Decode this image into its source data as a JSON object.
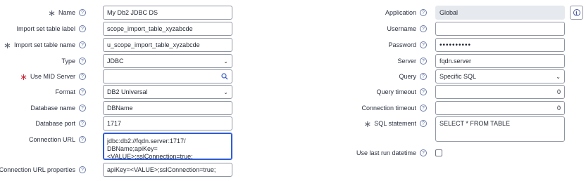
{
  "left": {
    "name": {
      "label": "Name",
      "value": "My Db2 JDBC DS"
    },
    "import_set_label": {
      "label": "Import set table label",
      "value": "scope_import_table_xyzabcde"
    },
    "import_set_name": {
      "label": "Import set table name",
      "value": "u_scope_import_table_xyzabcde"
    },
    "type": {
      "label": "Type",
      "value": "JDBC"
    },
    "use_mid_server": {
      "label": "Use MID Server",
      "value": ""
    },
    "format": {
      "label": "Format",
      "value": "DB2 Universal"
    },
    "database_name": {
      "label": "Database name",
      "value": "DBName"
    },
    "database_port": {
      "label": "Database port",
      "value": "1717"
    },
    "connection_url": {
      "label": "Connection URL",
      "value": "jdbc:db2://fqdn.server:1717/ DBName;apiKey=<VALUE>;sslConnection=true;"
    },
    "connection_url_properties": {
      "label": "Connection URL properties",
      "value": "apiKey=<VALUE>;sslConnection=true;"
    }
  },
  "right": {
    "application": {
      "label": "Application",
      "value": "Global"
    },
    "username": {
      "label": "Username",
      "value": ""
    },
    "password": {
      "label": "Password",
      "value": "••••••••••"
    },
    "server": {
      "label": "Server",
      "value": "fqdn.server"
    },
    "query": {
      "label": "Query",
      "value": "Specific SQL"
    },
    "query_timeout": {
      "label": "Query timeout",
      "value": "0"
    },
    "connection_timeout": {
      "label": "Connection timeout",
      "value": "0"
    },
    "sql_statement": {
      "label": "SQL statement",
      "value": "SELECT * FROM TABLE"
    },
    "use_last_run_datetime": {
      "label": "Use last run datetime",
      "checked": false
    }
  },
  "icons": {
    "help": "?",
    "chevron": "⌄",
    "info": "i",
    "required_marker": "∗"
  },
  "colors": {
    "required_mandatory": "#c8283a",
    "required_filled": "#5d6470",
    "focus_border": "#2e5bd6",
    "readonly_bg": "#e6e9ee"
  }
}
